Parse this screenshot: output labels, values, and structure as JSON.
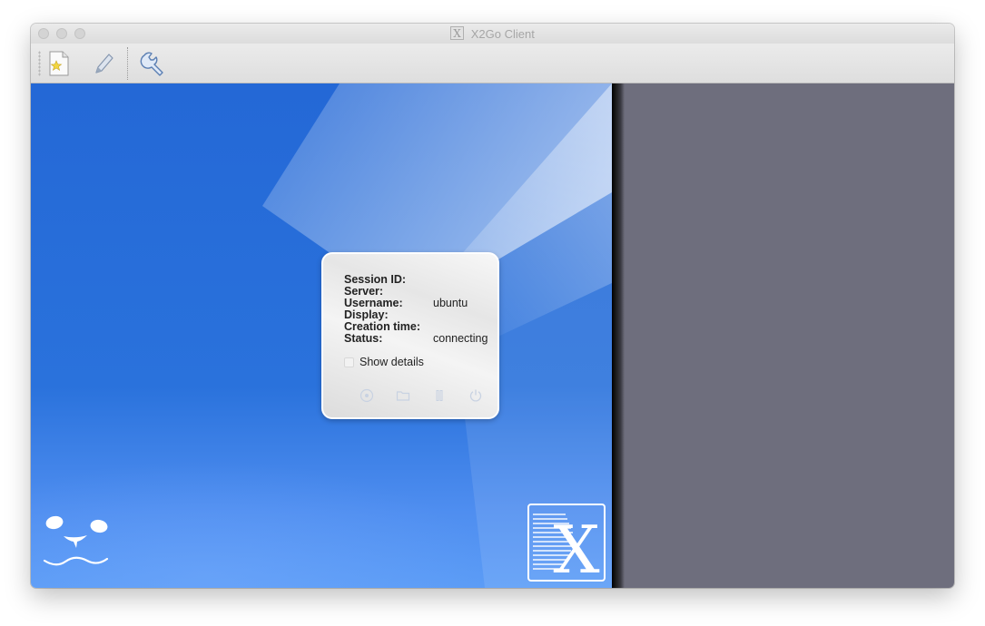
{
  "window": {
    "title": "X2Go Client"
  },
  "toolbar": {
    "items": [
      {
        "name": "new-session",
        "icon": "new-session-icon"
      },
      {
        "name": "edit-session",
        "icon": "pencil-icon"
      },
      {
        "name": "settings",
        "icon": "wrench-icon"
      }
    ]
  },
  "session": {
    "fields": [
      {
        "label": "Session ID:",
        "value": ""
      },
      {
        "label": "Server:",
        "value": ""
      },
      {
        "label": "Username:",
        "value": "ubuntu"
      },
      {
        "label": "Display:",
        "value": ""
      },
      {
        "label": "Creation time:",
        "value": ""
      },
      {
        "label": "Status:",
        "value": "connecting"
      }
    ],
    "show_details_label": "Show details",
    "show_details_checked": false,
    "controls": [
      "applications-icon",
      "folder-icon",
      "pause-icon",
      "power-icon"
    ]
  },
  "colors": {
    "desktop_blue": "#2468d6",
    "right_pane": "#6e6e7d"
  }
}
